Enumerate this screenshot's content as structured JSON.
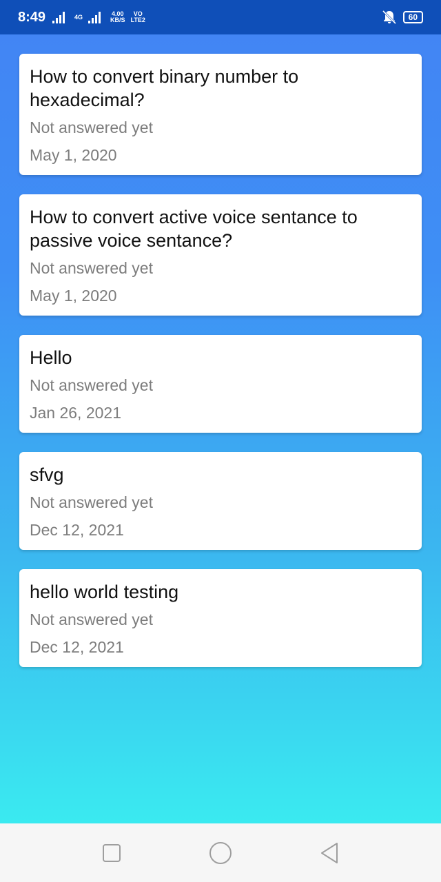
{
  "status_bar": {
    "time": "8:49",
    "net_type": "4G",
    "speed_value": "4.00",
    "speed_unit": "KB/S",
    "volte_top": "VO",
    "volte_bottom": "LTE2",
    "battery": "60",
    "icons": [
      "signal-icon",
      "signal-icon",
      "mute-icon",
      "battery-icon"
    ]
  },
  "questions": [
    {
      "title": "How to convert binary number to hexadecimal?",
      "status": "Not answered yet",
      "date": "May 1, 2020"
    },
    {
      "title": "How to convert active voice sentance to passive voice sentance?",
      "status": "Not answered yet",
      "date": "May 1, 2020"
    },
    {
      "title": "Hello",
      "status": "Not answered yet",
      "date": "Jan 26, 2021"
    },
    {
      "title": "sfvg",
      "status": "Not answered yet",
      "date": "Dec 12, 2021"
    },
    {
      "title": "hello world testing",
      "status": "Not answered yet",
      "date": "Dec 12, 2021"
    }
  ],
  "nav": {
    "icons": [
      "recent-apps-icon",
      "home-icon",
      "back-icon"
    ]
  },
  "colors": {
    "status_bar": "#0f4fb8",
    "gradient_top": "#4285f4",
    "gradient_bottom": "#3aeaf0",
    "card": "#ffffff",
    "secondary_text": "#7d7d7d"
  }
}
